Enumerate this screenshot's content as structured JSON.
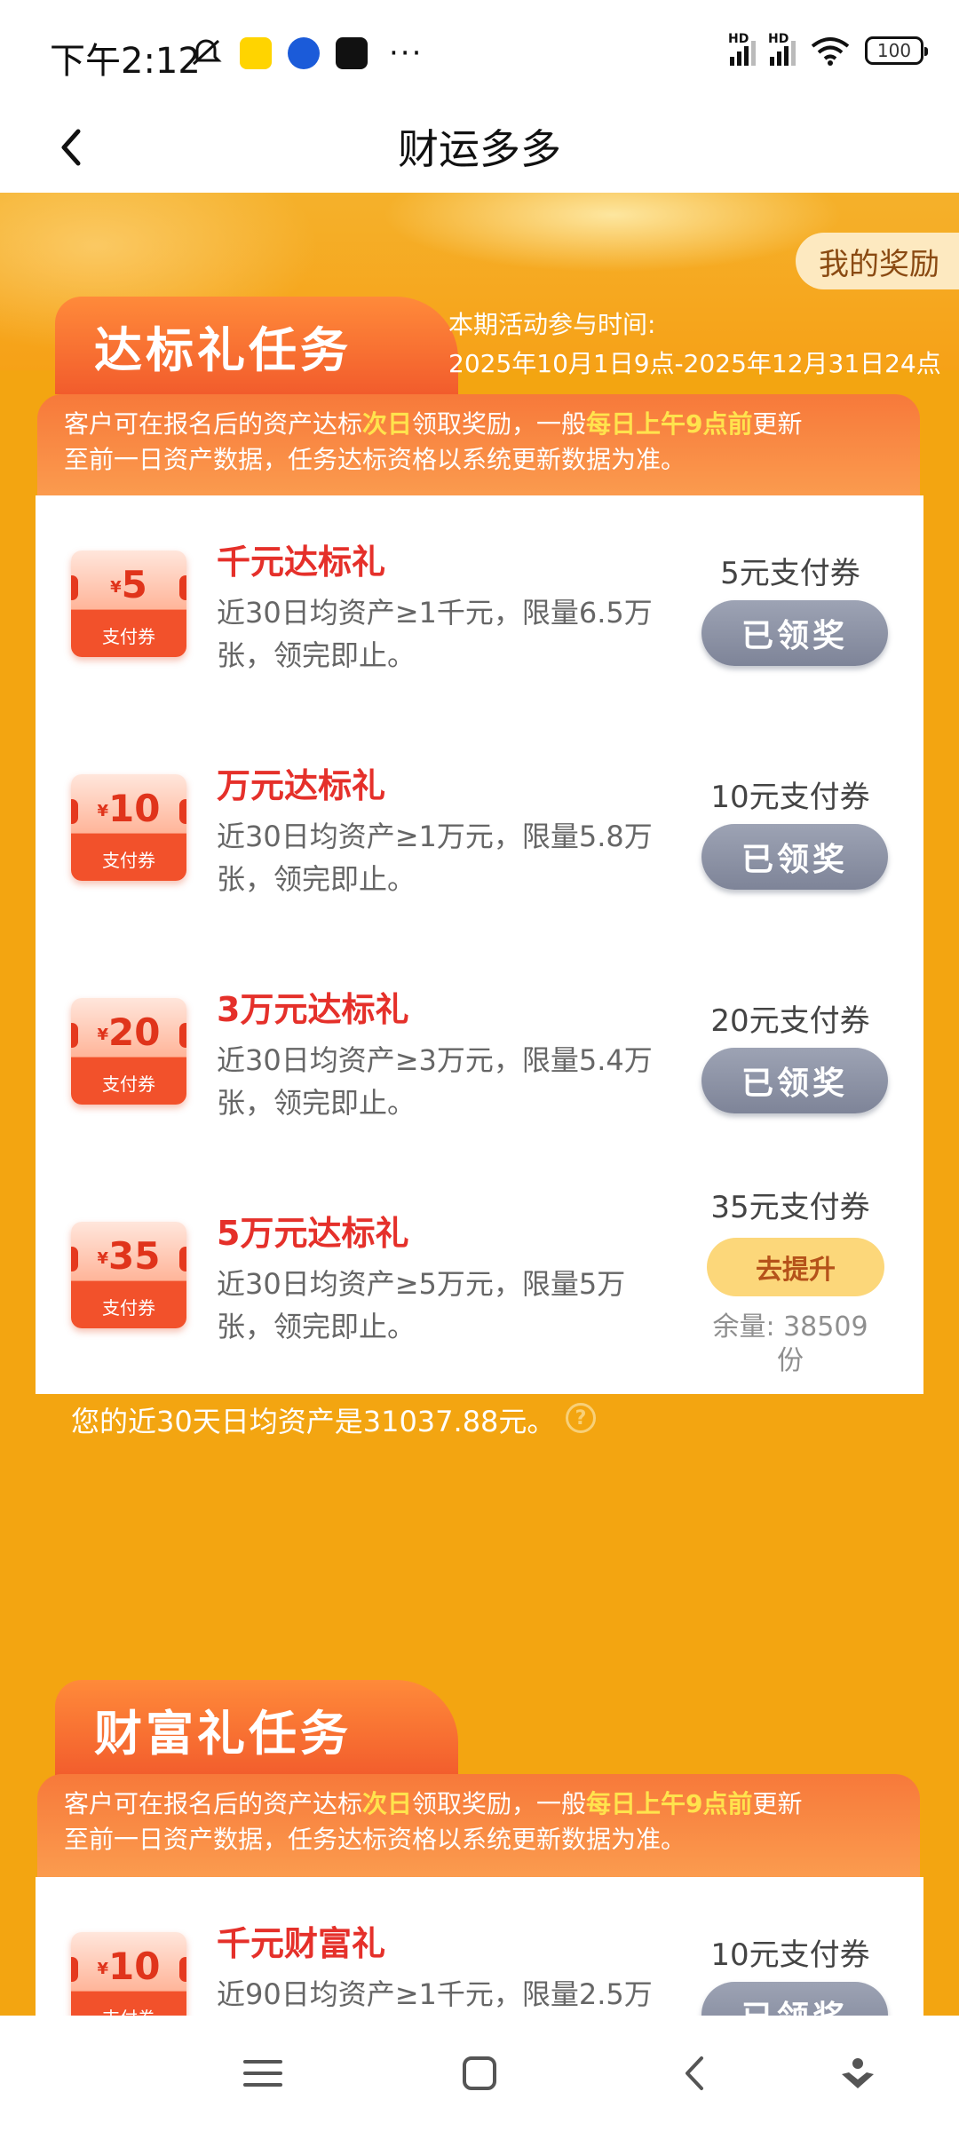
{
  "status_bar": {
    "time": "下午2:12",
    "battery": "100"
  },
  "header": {
    "title": "财运多多"
  },
  "banner": {
    "my_reward": "我的奖励"
  },
  "section1": {
    "title": "达标礼任务",
    "time_label": "本期活动参与时间:",
    "time_range": "2025年10月1日9点-2025年12月31日24点",
    "notice": {
      "p1": "客户可在报名后的资产达标",
      "h1": "次日",
      "p2": "领取奖励，一般",
      "h2": "每日上午9点前",
      "p3": "更新",
      "line2": "至前一日资产数据，任务达标资格以系统更新数据为准。"
    },
    "tasks": [
      {
        "coupon_amount": "5",
        "coupon_label": "支付券",
        "title": "千元达标礼",
        "desc": "近30日均资产≥1千元，限量6.5万张，领完即止。",
        "prize": "5元支付券",
        "button": "已领奖",
        "status": "done"
      },
      {
        "coupon_amount": "10",
        "coupon_label": "支付券",
        "title": "万元达标礼",
        "desc": "近30日均资产≥1万元，限量5.8万张，领完即止。",
        "prize": "10元支付券",
        "button": "已领奖",
        "status": "done"
      },
      {
        "coupon_amount": "20",
        "coupon_label": "支付券",
        "title": "3万元达标礼",
        "desc": "近30日均资产≥3万元，限量5.4万张，领完即止。",
        "prize": "20元支付券",
        "button": "已领奖",
        "status": "done"
      },
      {
        "coupon_amount": "35",
        "coupon_label": "支付券",
        "title": "5万元达标礼",
        "desc": "近30日均资产≥5万元，限量5万张，领完即止。",
        "prize": "35元支付券",
        "button": "去提升",
        "status": "go",
        "remain_line1": "余量: 38509",
        "remain_line2": "份"
      }
    ],
    "avg_assets": "您的近30天日均资产是31037.88元。"
  },
  "section2": {
    "title": "财富礼任务",
    "notice": {
      "p1": "客户可在报名后的资产达标",
      "h1": "次日",
      "p2": "领取奖励，一般",
      "h2": "每日上午9点前",
      "p3": "更新",
      "line2": "至前一日资产数据，任务达标资格以系统更新数据为准。"
    },
    "task": {
      "coupon_amount": "10",
      "coupon_label": "支付券",
      "title": "千元财富礼",
      "desc": "近90日均资产≥1千元，限量2.5万",
      "prize": "10元支付券",
      "button": "已领奖"
    }
  },
  "colors": {
    "background": "#f3a511",
    "title_red": "#e5302a",
    "highlight_yellow": "#ffe34d"
  }
}
